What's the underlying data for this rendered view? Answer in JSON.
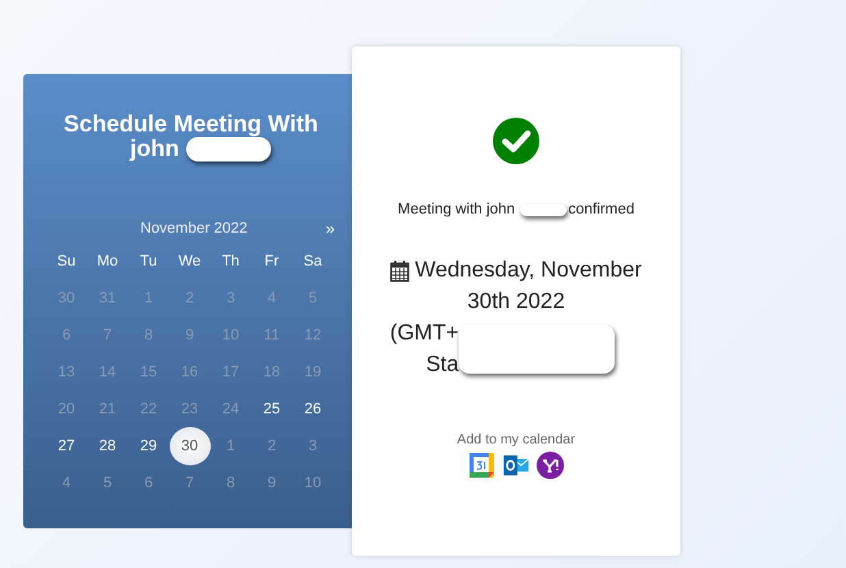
{
  "scheduler": {
    "title": "Schedule Meeting With",
    "title_name": "john",
    "month": "November 2022",
    "next": "»",
    "weekdays": [
      "Su",
      "Mo",
      "Tu",
      "We",
      "Th",
      "Fr",
      "Sa"
    ],
    "weeks": [
      [
        {
          "day": "30",
          "disabled": true,
          "selected": false
        },
        {
          "day": "31",
          "disabled": true,
          "selected": false
        },
        {
          "day": "1",
          "disabled": true,
          "selected": false
        },
        {
          "day": "2",
          "disabled": true,
          "selected": false
        },
        {
          "day": "3",
          "disabled": true,
          "selected": false
        },
        {
          "day": "4",
          "disabled": true,
          "selected": false
        },
        {
          "day": "5",
          "disabled": true,
          "selected": false
        }
      ],
      [
        {
          "day": "6",
          "disabled": true,
          "selected": false
        },
        {
          "day": "7",
          "disabled": true,
          "selected": false
        },
        {
          "day": "8",
          "disabled": true,
          "selected": false
        },
        {
          "day": "9",
          "disabled": true,
          "selected": false
        },
        {
          "day": "10",
          "disabled": true,
          "selected": false
        },
        {
          "day": "11",
          "disabled": true,
          "selected": false
        },
        {
          "day": "12",
          "disabled": true,
          "selected": false
        }
      ],
      [
        {
          "day": "13",
          "disabled": true,
          "selected": false
        },
        {
          "day": "14",
          "disabled": true,
          "selected": false
        },
        {
          "day": "15",
          "disabled": true,
          "selected": false
        },
        {
          "day": "16",
          "disabled": true,
          "selected": false
        },
        {
          "day": "17",
          "disabled": true,
          "selected": false
        },
        {
          "day": "18",
          "disabled": true,
          "selected": false
        },
        {
          "day": "19",
          "disabled": true,
          "selected": false
        }
      ],
      [
        {
          "day": "20",
          "disabled": true,
          "selected": false
        },
        {
          "day": "21",
          "disabled": true,
          "selected": false
        },
        {
          "day": "22",
          "disabled": true,
          "selected": false
        },
        {
          "day": "23",
          "disabled": true,
          "selected": false
        },
        {
          "day": "24",
          "disabled": true,
          "selected": false
        },
        {
          "day": "25",
          "disabled": false,
          "selected": false
        },
        {
          "day": "26",
          "disabled": false,
          "selected": false
        }
      ],
      [
        {
          "day": "27",
          "disabled": false,
          "selected": false
        },
        {
          "day": "28",
          "disabled": false,
          "selected": false
        },
        {
          "day": "29",
          "disabled": false,
          "selected": false
        },
        {
          "day": "30",
          "disabled": false,
          "selected": true
        },
        {
          "day": "1",
          "disabled": true,
          "selected": false
        },
        {
          "day": "2",
          "disabled": true,
          "selected": false
        },
        {
          "day": "3",
          "disabled": true,
          "selected": false
        }
      ],
      [
        {
          "day": "4",
          "disabled": true,
          "selected": false
        },
        {
          "day": "5",
          "disabled": true,
          "selected": false
        },
        {
          "day": "6",
          "disabled": true,
          "selected": false
        },
        {
          "day": "7",
          "disabled": true,
          "selected": false
        },
        {
          "day": "8",
          "disabled": true,
          "selected": false
        },
        {
          "day": "9",
          "disabled": true,
          "selected": false
        },
        {
          "day": "10",
          "disabled": true,
          "selected": false
        }
      ]
    ]
  },
  "confirmation": {
    "message_start": "Meeting with john",
    "message_end": "confirmed",
    "date_line_1": "Wednesday, November",
    "date_line_2": "30th 2022",
    "timezone_start": "(GMT+",
    "timezone_next": "Sta",
    "add_to_calendar": "Add to my calendar",
    "calendars": [
      {
        "kind": "google"
      },
      {
        "kind": "outlook"
      },
      {
        "kind": "yahoo"
      }
    ]
  }
}
